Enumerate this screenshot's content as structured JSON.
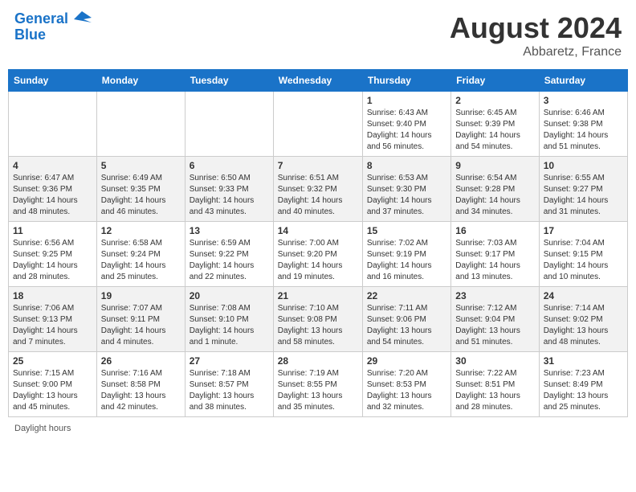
{
  "header": {
    "logo_line1": "General",
    "logo_line2": "Blue",
    "main_title": "August 2024",
    "subtitle": "Abbaretz, France"
  },
  "calendar": {
    "days_of_week": [
      "Sunday",
      "Monday",
      "Tuesday",
      "Wednesday",
      "Thursday",
      "Friday",
      "Saturday"
    ],
    "weeks": [
      {
        "cells": [
          {
            "day": "",
            "info": ""
          },
          {
            "day": "",
            "info": ""
          },
          {
            "day": "",
            "info": ""
          },
          {
            "day": "",
            "info": ""
          },
          {
            "day": "1",
            "info": "Sunrise: 6:43 AM\nSunset: 9:40 PM\nDaylight: 14 hours\nand 56 minutes."
          },
          {
            "day": "2",
            "info": "Sunrise: 6:45 AM\nSunset: 9:39 PM\nDaylight: 14 hours\nand 54 minutes."
          },
          {
            "day": "3",
            "info": "Sunrise: 6:46 AM\nSunset: 9:38 PM\nDaylight: 14 hours\nand 51 minutes."
          }
        ]
      },
      {
        "cells": [
          {
            "day": "4",
            "info": "Sunrise: 6:47 AM\nSunset: 9:36 PM\nDaylight: 14 hours\nand 48 minutes."
          },
          {
            "day": "5",
            "info": "Sunrise: 6:49 AM\nSunset: 9:35 PM\nDaylight: 14 hours\nand 46 minutes."
          },
          {
            "day": "6",
            "info": "Sunrise: 6:50 AM\nSunset: 9:33 PM\nDaylight: 14 hours\nand 43 minutes."
          },
          {
            "day": "7",
            "info": "Sunrise: 6:51 AM\nSunset: 9:32 PM\nDaylight: 14 hours\nand 40 minutes."
          },
          {
            "day": "8",
            "info": "Sunrise: 6:53 AM\nSunset: 9:30 PM\nDaylight: 14 hours\nand 37 minutes."
          },
          {
            "day": "9",
            "info": "Sunrise: 6:54 AM\nSunset: 9:28 PM\nDaylight: 14 hours\nand 34 minutes."
          },
          {
            "day": "10",
            "info": "Sunrise: 6:55 AM\nSunset: 9:27 PM\nDaylight: 14 hours\nand 31 minutes."
          }
        ]
      },
      {
        "cells": [
          {
            "day": "11",
            "info": "Sunrise: 6:56 AM\nSunset: 9:25 PM\nDaylight: 14 hours\nand 28 minutes."
          },
          {
            "day": "12",
            "info": "Sunrise: 6:58 AM\nSunset: 9:24 PM\nDaylight: 14 hours\nand 25 minutes."
          },
          {
            "day": "13",
            "info": "Sunrise: 6:59 AM\nSunset: 9:22 PM\nDaylight: 14 hours\nand 22 minutes."
          },
          {
            "day": "14",
            "info": "Sunrise: 7:00 AM\nSunset: 9:20 PM\nDaylight: 14 hours\nand 19 minutes."
          },
          {
            "day": "15",
            "info": "Sunrise: 7:02 AM\nSunset: 9:19 PM\nDaylight: 14 hours\nand 16 minutes."
          },
          {
            "day": "16",
            "info": "Sunrise: 7:03 AM\nSunset: 9:17 PM\nDaylight: 14 hours\nand 13 minutes."
          },
          {
            "day": "17",
            "info": "Sunrise: 7:04 AM\nSunset: 9:15 PM\nDaylight: 14 hours\nand 10 minutes."
          }
        ]
      },
      {
        "cells": [
          {
            "day": "18",
            "info": "Sunrise: 7:06 AM\nSunset: 9:13 PM\nDaylight: 14 hours\nand 7 minutes."
          },
          {
            "day": "19",
            "info": "Sunrise: 7:07 AM\nSunset: 9:11 PM\nDaylight: 14 hours\nand 4 minutes."
          },
          {
            "day": "20",
            "info": "Sunrise: 7:08 AM\nSunset: 9:10 PM\nDaylight: 14 hours\nand 1 minute."
          },
          {
            "day": "21",
            "info": "Sunrise: 7:10 AM\nSunset: 9:08 PM\nDaylight: 13 hours\nand 58 minutes."
          },
          {
            "day": "22",
            "info": "Sunrise: 7:11 AM\nSunset: 9:06 PM\nDaylight: 13 hours\nand 54 minutes."
          },
          {
            "day": "23",
            "info": "Sunrise: 7:12 AM\nSunset: 9:04 PM\nDaylight: 13 hours\nand 51 minutes."
          },
          {
            "day": "24",
            "info": "Sunrise: 7:14 AM\nSunset: 9:02 PM\nDaylight: 13 hours\nand 48 minutes."
          }
        ]
      },
      {
        "cells": [
          {
            "day": "25",
            "info": "Sunrise: 7:15 AM\nSunset: 9:00 PM\nDaylight: 13 hours\nand 45 minutes."
          },
          {
            "day": "26",
            "info": "Sunrise: 7:16 AM\nSunset: 8:58 PM\nDaylight: 13 hours\nand 42 minutes."
          },
          {
            "day": "27",
            "info": "Sunrise: 7:18 AM\nSunset: 8:57 PM\nDaylight: 13 hours\nand 38 minutes."
          },
          {
            "day": "28",
            "info": "Sunrise: 7:19 AM\nSunset: 8:55 PM\nDaylight: 13 hours\nand 35 minutes."
          },
          {
            "day": "29",
            "info": "Sunrise: 7:20 AM\nSunset: 8:53 PM\nDaylight: 13 hours\nand 32 minutes."
          },
          {
            "day": "30",
            "info": "Sunrise: 7:22 AM\nSunset: 8:51 PM\nDaylight: 13 hours\nand 28 minutes."
          },
          {
            "day": "31",
            "info": "Sunrise: 7:23 AM\nSunset: 8:49 PM\nDaylight: 13 hours\nand 25 minutes."
          }
        ]
      }
    ]
  },
  "footer": {
    "label": "Daylight hours"
  }
}
